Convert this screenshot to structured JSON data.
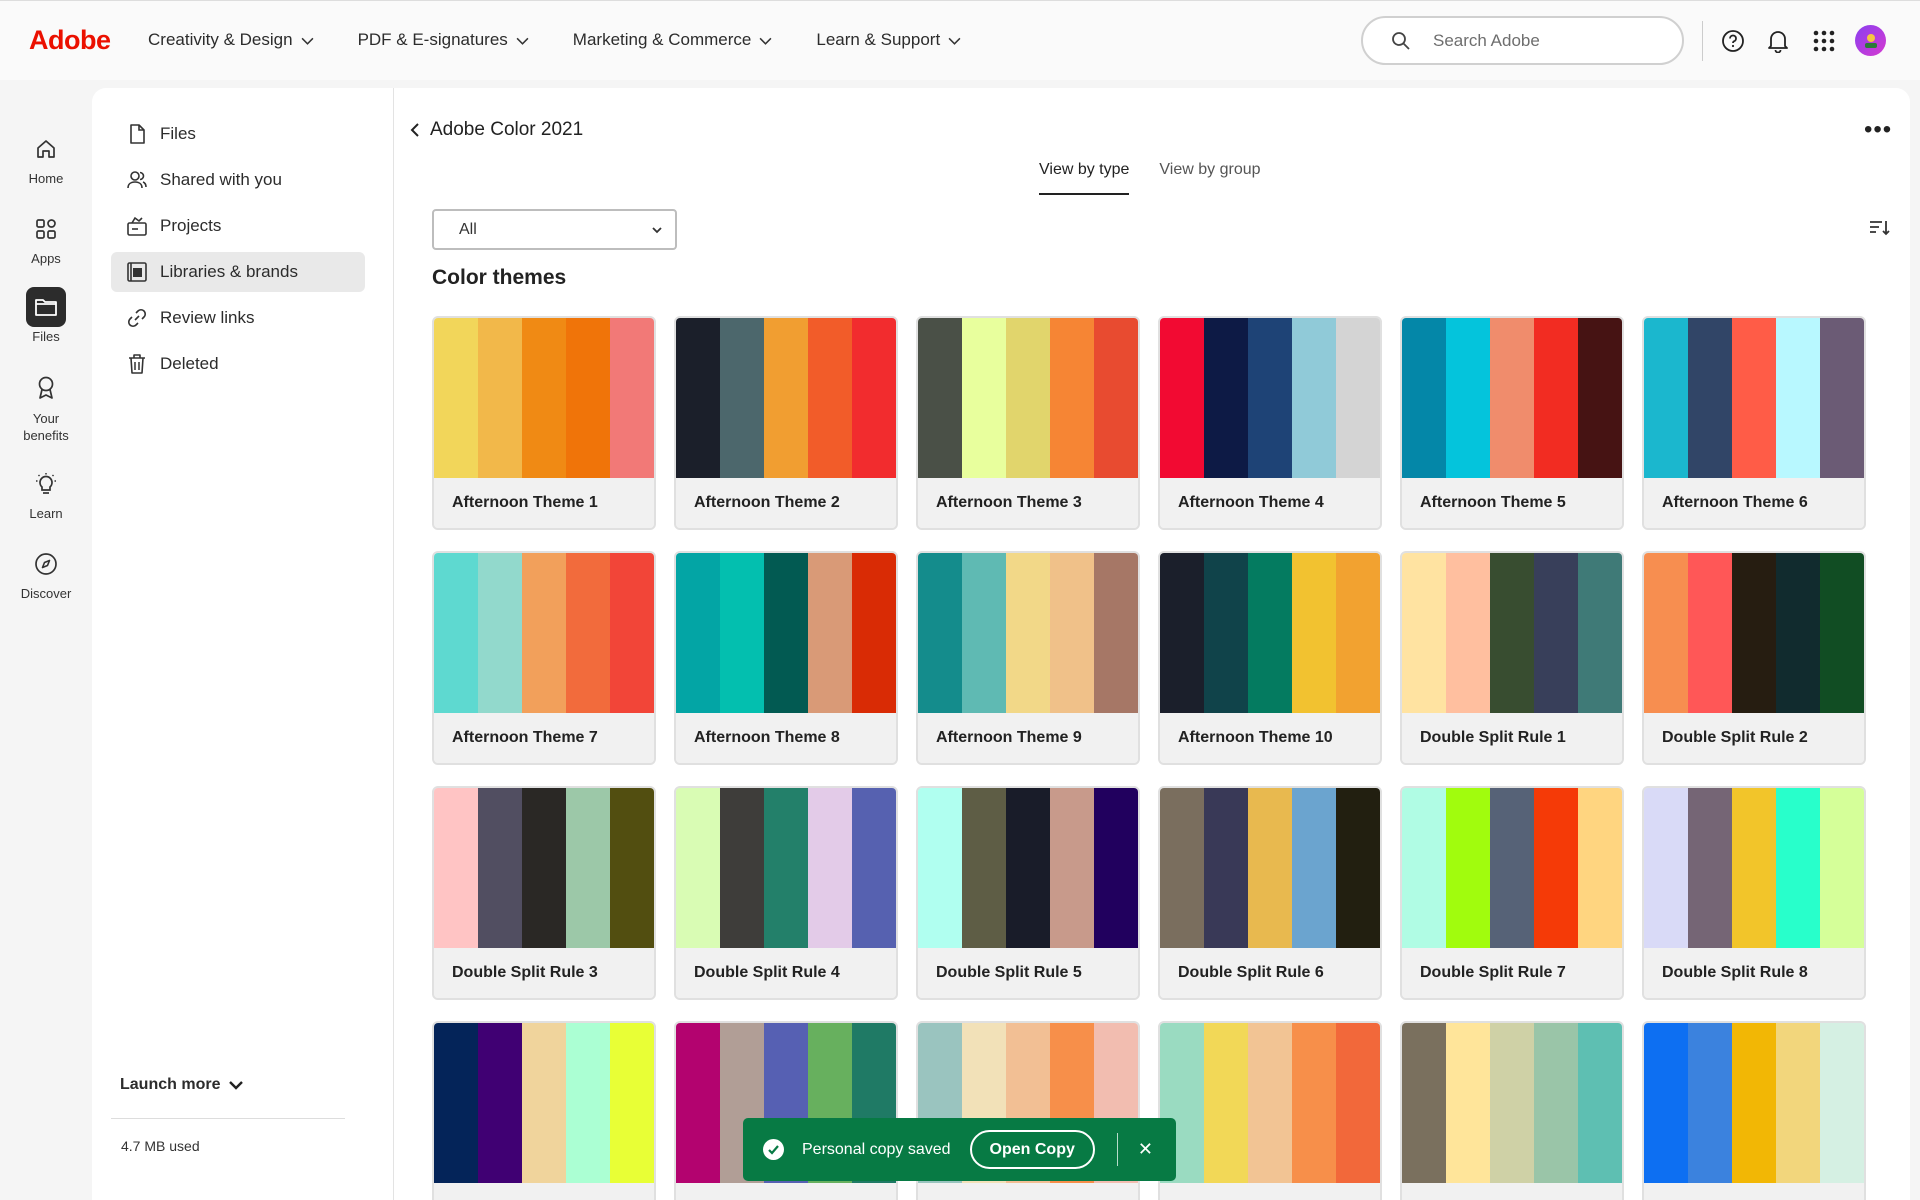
{
  "topnav": {
    "logo": "Adobe",
    "links": [
      {
        "label": "Creativity & Design"
      },
      {
        "label": "PDF & E-signatures"
      },
      {
        "label": "Marketing & Commerce"
      },
      {
        "label": "Learn & Support"
      }
    ],
    "search_placeholder": "Search Adobe"
  },
  "rail": {
    "items": [
      {
        "label": "Home",
        "icon": "home-icon"
      },
      {
        "label": "Apps",
        "icon": "apps-icon"
      },
      {
        "label": "Files",
        "icon": "folder-icon"
      },
      {
        "label": "Your benefits",
        "icon": "award-icon"
      },
      {
        "label": "Learn",
        "icon": "lightbulb-icon"
      },
      {
        "label": "Discover",
        "icon": "compass-icon"
      }
    ],
    "active": "Files"
  },
  "sidebar": {
    "items": [
      {
        "label": "Files",
        "icon": "file-icon"
      },
      {
        "label": "Shared with you",
        "icon": "users-icon"
      },
      {
        "label": "Projects",
        "icon": "projects-icon"
      },
      {
        "label": "Libraries & brands",
        "icon": "library-icon"
      },
      {
        "label": "Review links",
        "icon": "link-icon"
      },
      {
        "label": "Deleted",
        "icon": "trash-icon"
      }
    ],
    "active": "Libraries & brands",
    "launch_more": "Launch more",
    "storage": "4.7 MB used"
  },
  "main": {
    "breadcrumb": "Adobe Color 2021",
    "tabs": [
      {
        "label": "View by type"
      },
      {
        "label": "View by group"
      }
    ],
    "active_tab": "View by type",
    "filter_value": "All",
    "section_title": "Color themes",
    "themes": [
      {
        "name": "Afternoon Theme 1",
        "colors": [
          "#f2d65a",
          "#f2b84a",
          "#f08a14",
          "#f07409",
          "#f27977"
        ]
      },
      {
        "name": "Afternoon Theme 2",
        "colors": [
          "#1b1f2a",
          "#4c676c",
          "#f19e31",
          "#f25c29",
          "#f22c2e"
        ]
      },
      {
        "name": "Afternoon Theme 3",
        "colors": [
          "#4a5047",
          "#e8ff9d",
          "#e1d56c",
          "#f68534",
          "#e84b30"
        ]
      },
      {
        "name": "Afternoon Theme 4",
        "colors": [
          "#f20a32",
          "#0d1a45",
          "#1e4376",
          "#90cad8",
          "#d4d4d4"
        ]
      },
      {
        "name": "Afternoon Theme 5",
        "colors": [
          "#0487a8",
          "#04c4dc",
          "#f08c6c",
          "#f22c22",
          "#461313"
        ]
      },
      {
        "name": "Afternoon Theme 6",
        "colors": [
          "#1bb7ce",
          "#314567",
          "#ff5c47",
          "#b8f8ff",
          "#6b5b75"
        ]
      },
      {
        "name": "Afternoon Theme 7",
        "colors": [
          "#5ed9d0",
          "#92d9cc",
          "#f2a05b",
          "#f26b3c",
          "#f24538"
        ]
      },
      {
        "name": "Afternoon Theme 8",
        "colors": [
          "#03a5a5",
          "#03bfaf",
          "#025a52",
          "#d99a77",
          "#d92b05"
        ]
      },
      {
        "name": "Afternoon Theme 9",
        "colors": [
          "#148c8c",
          "#5fbab3",
          "#f2d888",
          "#f0c189",
          "#a67766"
        ]
      },
      {
        "name": "Afternoon Theme 10",
        "colors": [
          "#1b1f2b",
          "#10434a",
          "#047b60",
          "#f2c230",
          "#f2a230"
        ]
      },
      {
        "name": "Double Split Rule 1",
        "colors": [
          "#ffe3a1",
          "#ffbf9f",
          "#384d30",
          "#383f5a",
          "#3f7a77"
        ]
      },
      {
        "name": "Double Split Rule 2",
        "colors": [
          "#f78e50",
          "#ff5757",
          "#261d11",
          "#112b2e",
          "#114d23"
        ]
      },
      {
        "name": "Double Split Rule 3",
        "colors": [
          "#ffc4c4",
          "#514e61",
          "#2a2825",
          "#9cc8a8",
          "#524e10"
        ]
      },
      {
        "name": "Double Split Rule 4",
        "colors": [
          "#d9fcb4",
          "#3e3d3a",
          "#23806a",
          "#e3cbe8",
          "#5661b0"
        ]
      },
      {
        "name": "Double Split Rule 5",
        "colors": [
          "#b0fff0",
          "#5e5d45",
          "#191c29",
          "#c89a8b",
          "#21005e"
        ]
      },
      {
        "name": "Double Split Rule 6",
        "colors": [
          "#7a6e5e",
          "#393957",
          "#e8b94f",
          "#6ba4cf",
          "#221f10"
        ]
      },
      {
        "name": "Double Split Rule 7",
        "colors": [
          "#b0fce4",
          "#a1fc0d",
          "#566277",
          "#f53a07",
          "#ffd580"
        ]
      },
      {
        "name": "Double Split Rule 8",
        "colors": [
          "#d9daf7",
          "#756575",
          "#f2c52a",
          "#28ffcb",
          "#d5ff99"
        ]
      },
      {
        "name": "",
        "colors": [
          "#042459",
          "#400073",
          "#f0d49c",
          "#abffd3",
          "#e8ff36"
        ]
      },
      {
        "name": "",
        "colors": [
          "#b3036f",
          "#b19e96",
          "#5660b3",
          "#67b05e",
          "#1f7a65"
        ]
      },
      {
        "name": "",
        "colors": [
          "#9ac4bf",
          "#f2e1b8",
          "#f2bf94",
          "#f78f4a",
          "#f2bdb0"
        ]
      },
      {
        "name": "",
        "colors": [
          "#9adbc1",
          "#f2d857",
          "#f2c494",
          "#f78f4a",
          "#f2683a"
        ]
      },
      {
        "name": "",
        "colors": [
          "#7a705e",
          "#ffe59a",
          "#cfd1a6",
          "#9ac5a8",
          "#5ebfb2"
        ]
      },
      {
        "name": "",
        "colors": [
          "#0d6ff2",
          "#3b82de",
          "#f2b705",
          "#f2d67c",
          "#d5f0e3"
        ]
      }
    ]
  },
  "toast": {
    "message": "Personal copy saved",
    "action": "Open Copy",
    "color": "#077a44"
  },
  "colors": {
    "brand_red": "#eb1000"
  }
}
